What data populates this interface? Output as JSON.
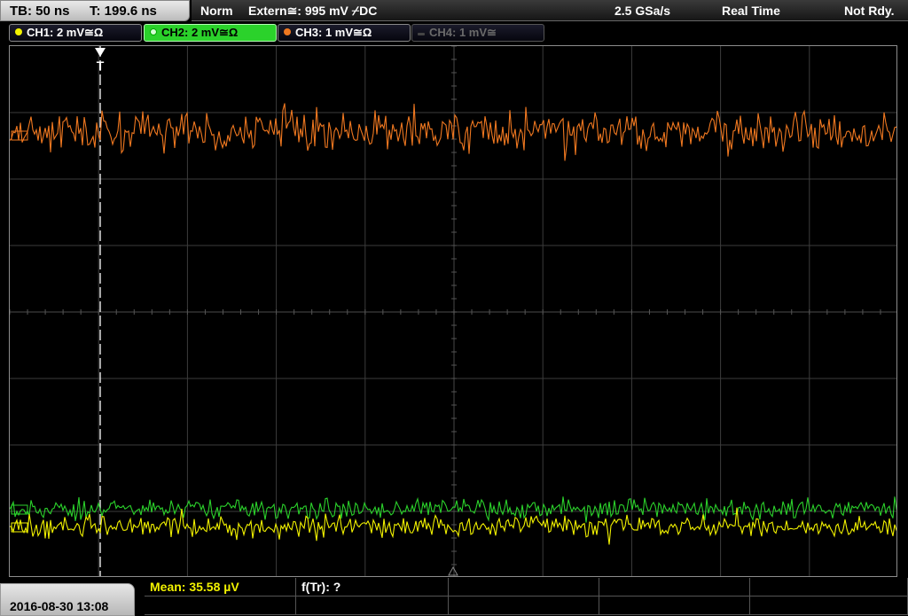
{
  "timebase": {
    "tb": "TB: 50 ns",
    "t": "T: 199.6 ns"
  },
  "status": {
    "mode": "Norm",
    "trigger": "Extern≅: 995 mV ⌿DC",
    "sample_rate": "2.5 GSa/s",
    "acq": "Real Time",
    "state": "Not Rdy."
  },
  "channels": [
    {
      "label": "CH1: 2 mV≅Ω",
      "color": "#f2f200"
    },
    {
      "label": "CH2: 2 mV≅Ω",
      "color": "#2bd22b"
    },
    {
      "label": "CH3: 1 mV≅Ω",
      "color": "#f07820"
    },
    {
      "label": "CH4: 1 mV≅",
      "color": "#6a6a6a"
    }
  ],
  "trigger_marker": "T",
  "date": "2016-08-30 13:08",
  "measurements": {
    "mean": "Mean: 35.58 µV",
    "freq": "f(Tr): ?"
  },
  "colors": {
    "grid": "#3c3c3c",
    "ch1": "#f2f200",
    "ch2": "#2bd22b",
    "ch3": "#f07820"
  }
}
